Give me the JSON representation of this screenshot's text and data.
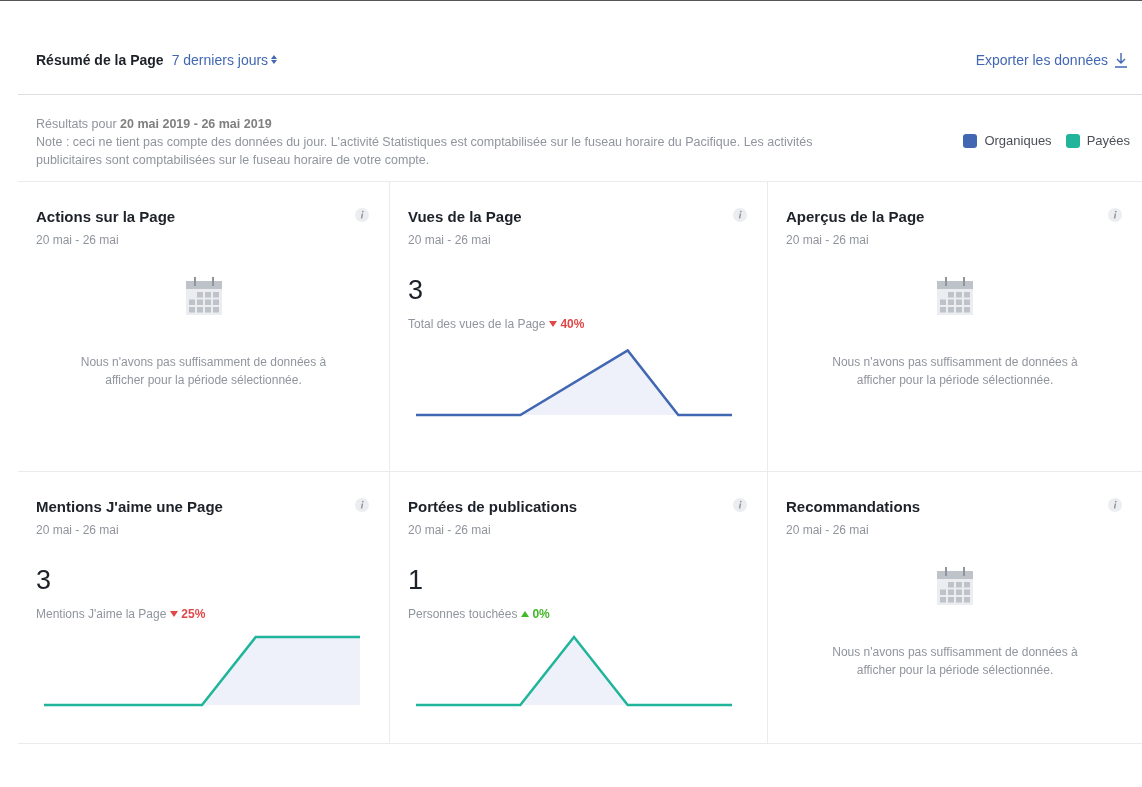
{
  "header": {
    "title": "Résumé de la Page",
    "period": "7 derniers jours",
    "export": "Exporter les données"
  },
  "info": {
    "results_prefix": "Résultats pour",
    "results_range": "20 mai 2019 - 26 mai 2019",
    "note": "Note : ceci ne tient pas compte des données du jour. L'activité Statistiques est comptabilisée sur le fuseau horaire du Pacifique. Les activités publicitaires sont comptabilisées sur le fuseau horaire de votre compte."
  },
  "legend": [
    {
      "label": "Organiques",
      "color": "#4267b2"
    },
    {
      "label": "Payées",
      "color": "#20b59a"
    }
  ],
  "cards": [
    {
      "kind": "empty",
      "title": "Actions sur la Page",
      "dates": "20 mai - 26 mai",
      "message": "Nous n'avons pas suffisamment de données à afficher pour la période sélectionnée."
    },
    {
      "kind": "metric",
      "title": "Vues de la Page",
      "dates": "20 mai - 26 mai",
      "value": "3",
      "label": "Total des vues de la Page",
      "rising": false,
      "change": "40%",
      "color": "#4267b2"
    },
    {
      "kind": "empty",
      "title": "Aperçus de la Page",
      "dates": "20 mai - 26 mai",
      "message": "Nous n'avons pas suffisamment de données à afficher pour la période sélectionnée."
    },
    {
      "kind": "metric",
      "title": "Mentions J'aime une Page",
      "dates": "20 mai - 26 mai",
      "value": "3",
      "label": "Mentions J'aime la Page",
      "rising": false,
      "change": "25%",
      "color": "#20b59a"
    },
    {
      "kind": "metric",
      "title": "Portées de publications",
      "dates": "20 mai - 26 mai",
      "value": "1",
      "label": "Personnes touchées",
      "rising": true,
      "change": "0%",
      "color": "#20b59a"
    },
    {
      "kind": "empty",
      "title": "Recommandations",
      "dates": "20 mai - 26 mai",
      "message": "Nous n'avons pas suffisamment de données à afficher pour la période sélectionnée."
    }
  ]
}
